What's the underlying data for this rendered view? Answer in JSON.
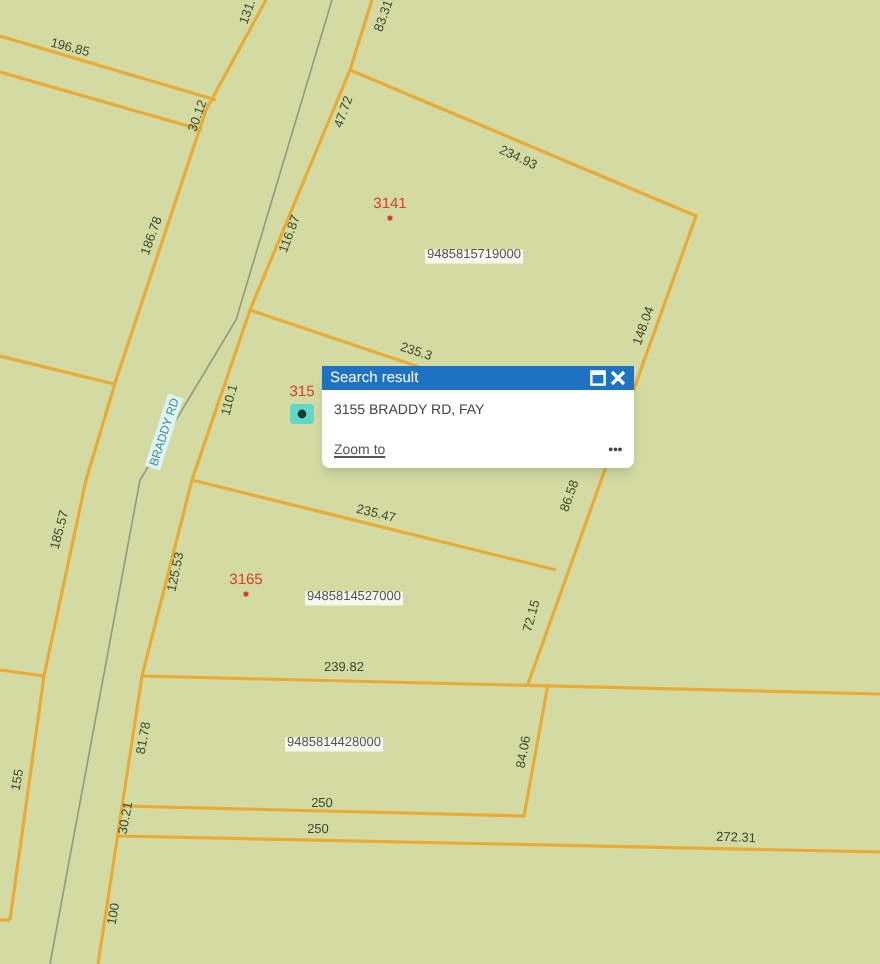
{
  "map": {
    "road_label": "BRADDY RD",
    "dimension_labels": [
      "196.85",
      "30.12",
      "131.",
      "83.31",
      "47.72",
      "234.93",
      "186.78",
      "116.87",
      "235.3",
      "148.04",
      "110.1",
      "185.57",
      "235.47",
      "125.53",
      "86.58",
      "72.15",
      "239.82",
      "81.78",
      "84.06",
      "155",
      "30.21",
      "250",
      "250",
      "272.31",
      "100"
    ],
    "parcel_ids": [
      "9485815719000",
      "9485814527000",
      "9485814428000"
    ],
    "address_labels": [
      "3141",
      "3165",
      "315"
    ]
  },
  "popup": {
    "title": "Search result",
    "address": "3155 BRADDY RD, FAY",
    "link": "Zoom to",
    "more": "•••"
  }
}
